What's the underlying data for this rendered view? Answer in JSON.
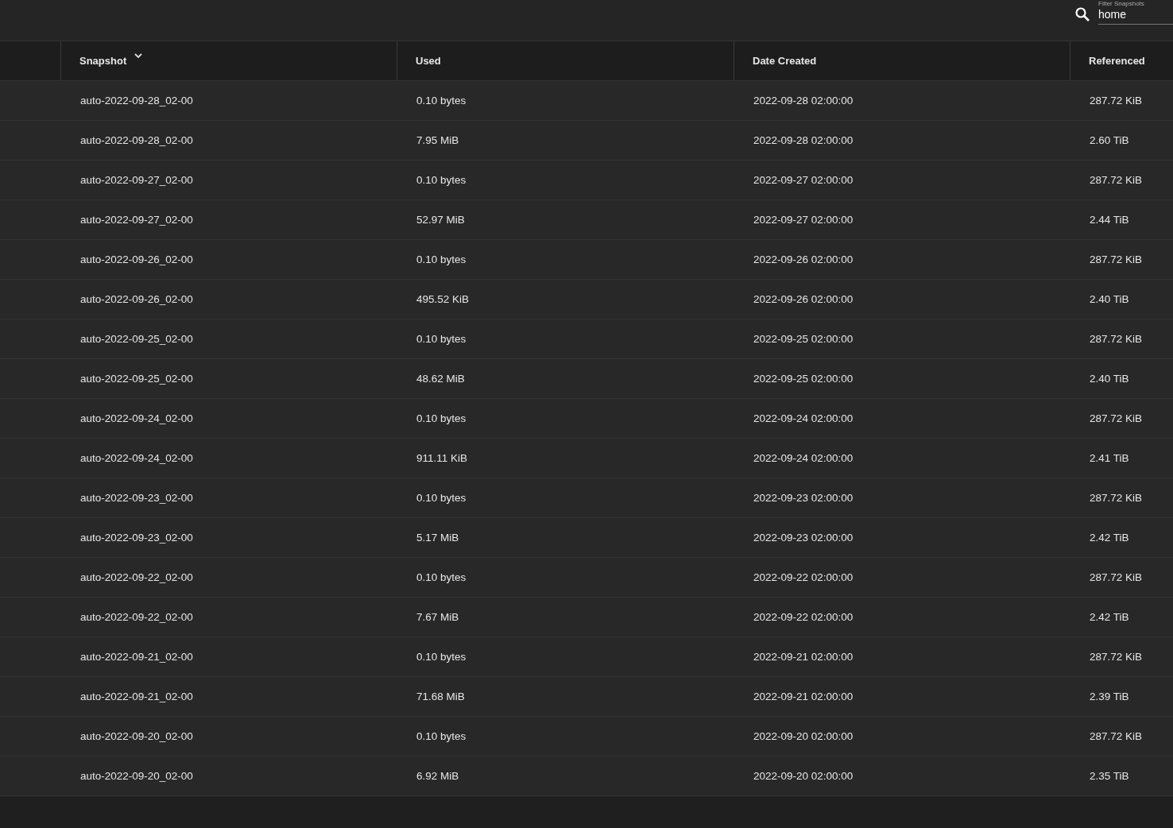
{
  "filter": {
    "label": "Filter Snapshots",
    "value": "home"
  },
  "table": {
    "columns": [
      {
        "label": "Snapshot",
        "sorted": true
      },
      {
        "label": "Used",
        "sorted": false
      },
      {
        "label": "Date Created",
        "sorted": false
      },
      {
        "label": "Referenced",
        "sorted": false
      }
    ],
    "rows": [
      [
        "auto-2022-09-28_02-00",
        "0.10 bytes",
        "2022-09-28 02:00:00",
        "287.72 KiB"
      ],
      [
        "auto-2022-09-28_02-00",
        "7.95 MiB",
        "2022-09-28 02:00:00",
        "2.60 TiB"
      ],
      [
        "auto-2022-09-27_02-00",
        "0.10 bytes",
        "2022-09-27 02:00:00",
        "287.72 KiB"
      ],
      [
        "auto-2022-09-27_02-00",
        "52.97 MiB",
        "2022-09-27 02:00:00",
        "2.44 TiB"
      ],
      [
        "auto-2022-09-26_02-00",
        "0.10 bytes",
        "2022-09-26 02:00:00",
        "287.72 KiB"
      ],
      [
        "auto-2022-09-26_02-00",
        "495.52 KiB",
        "2022-09-26 02:00:00",
        "2.40 TiB"
      ],
      [
        "auto-2022-09-25_02-00",
        "0.10 bytes",
        "2022-09-25 02:00:00",
        "287.72 KiB"
      ],
      [
        "auto-2022-09-25_02-00",
        "48.62 MiB",
        "2022-09-25 02:00:00",
        "2.40 TiB"
      ],
      [
        "auto-2022-09-24_02-00",
        "0.10 bytes",
        "2022-09-24 02:00:00",
        "287.72 KiB"
      ],
      [
        "auto-2022-09-24_02-00",
        "911.11 KiB",
        "2022-09-24 02:00:00",
        "2.41 TiB"
      ],
      [
        "auto-2022-09-23_02-00",
        "0.10 bytes",
        "2022-09-23 02:00:00",
        "287.72 KiB"
      ],
      [
        "auto-2022-09-23_02-00",
        "5.17 MiB",
        "2022-09-23 02:00:00",
        "2.42 TiB"
      ],
      [
        "auto-2022-09-22_02-00",
        "0.10 bytes",
        "2022-09-22 02:00:00",
        "287.72 KiB"
      ],
      [
        "auto-2022-09-22_02-00",
        "7.67 MiB",
        "2022-09-22 02:00:00",
        "2.42 TiB"
      ],
      [
        "auto-2022-09-21_02-00",
        "0.10 bytes",
        "2022-09-21 02:00:00",
        "287.72 KiB"
      ],
      [
        "auto-2022-09-21_02-00",
        "71.68 MiB",
        "2022-09-21 02:00:00",
        "2.39 TiB"
      ],
      [
        "auto-2022-09-20_02-00",
        "0.10 bytes",
        "2022-09-20 02:00:00",
        "287.72 KiB"
      ],
      [
        "auto-2022-09-20_02-00",
        "6.92 MiB",
        "2022-09-20 02:00:00",
        "2.35 TiB"
      ]
    ]
  }
}
